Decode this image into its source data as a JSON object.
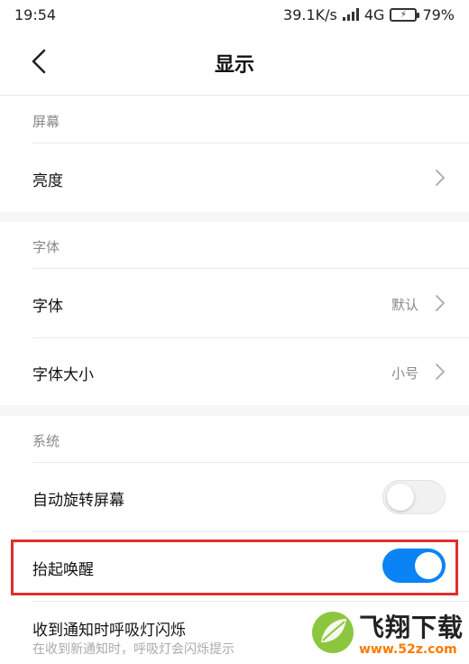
{
  "status_bar": {
    "time": "19:54",
    "network_speed": "39.1K/s",
    "network_type": "4G",
    "battery_percent": "79%"
  },
  "header": {
    "title": "显示",
    "back_icon": "chevron-left-icon"
  },
  "sections": {
    "screen": {
      "label": "屏幕",
      "brightness": {
        "label": "亮度"
      }
    },
    "font": {
      "label": "字体",
      "font_row": {
        "label": "字体",
        "value": "默认"
      },
      "font_size_row": {
        "label": "字体大小",
        "value": "小号"
      }
    },
    "system": {
      "label": "系统",
      "auto_rotate": {
        "label": "自动旋转屏幕",
        "enabled": false
      },
      "lift_to_wake": {
        "label": "抬起唤醒",
        "enabled": true
      },
      "notification_light": {
        "label": "收到通知时呼吸灯闪烁",
        "description": "在收到新通知时，呼吸灯会闪烁提示"
      }
    }
  },
  "colors": {
    "accent": "#0a84f4",
    "highlight_border": "#e02e2e",
    "watermark_orange": "#ff7a00"
  },
  "watermark": {
    "main": "飞翔下载",
    "url": "www.52z.com"
  }
}
